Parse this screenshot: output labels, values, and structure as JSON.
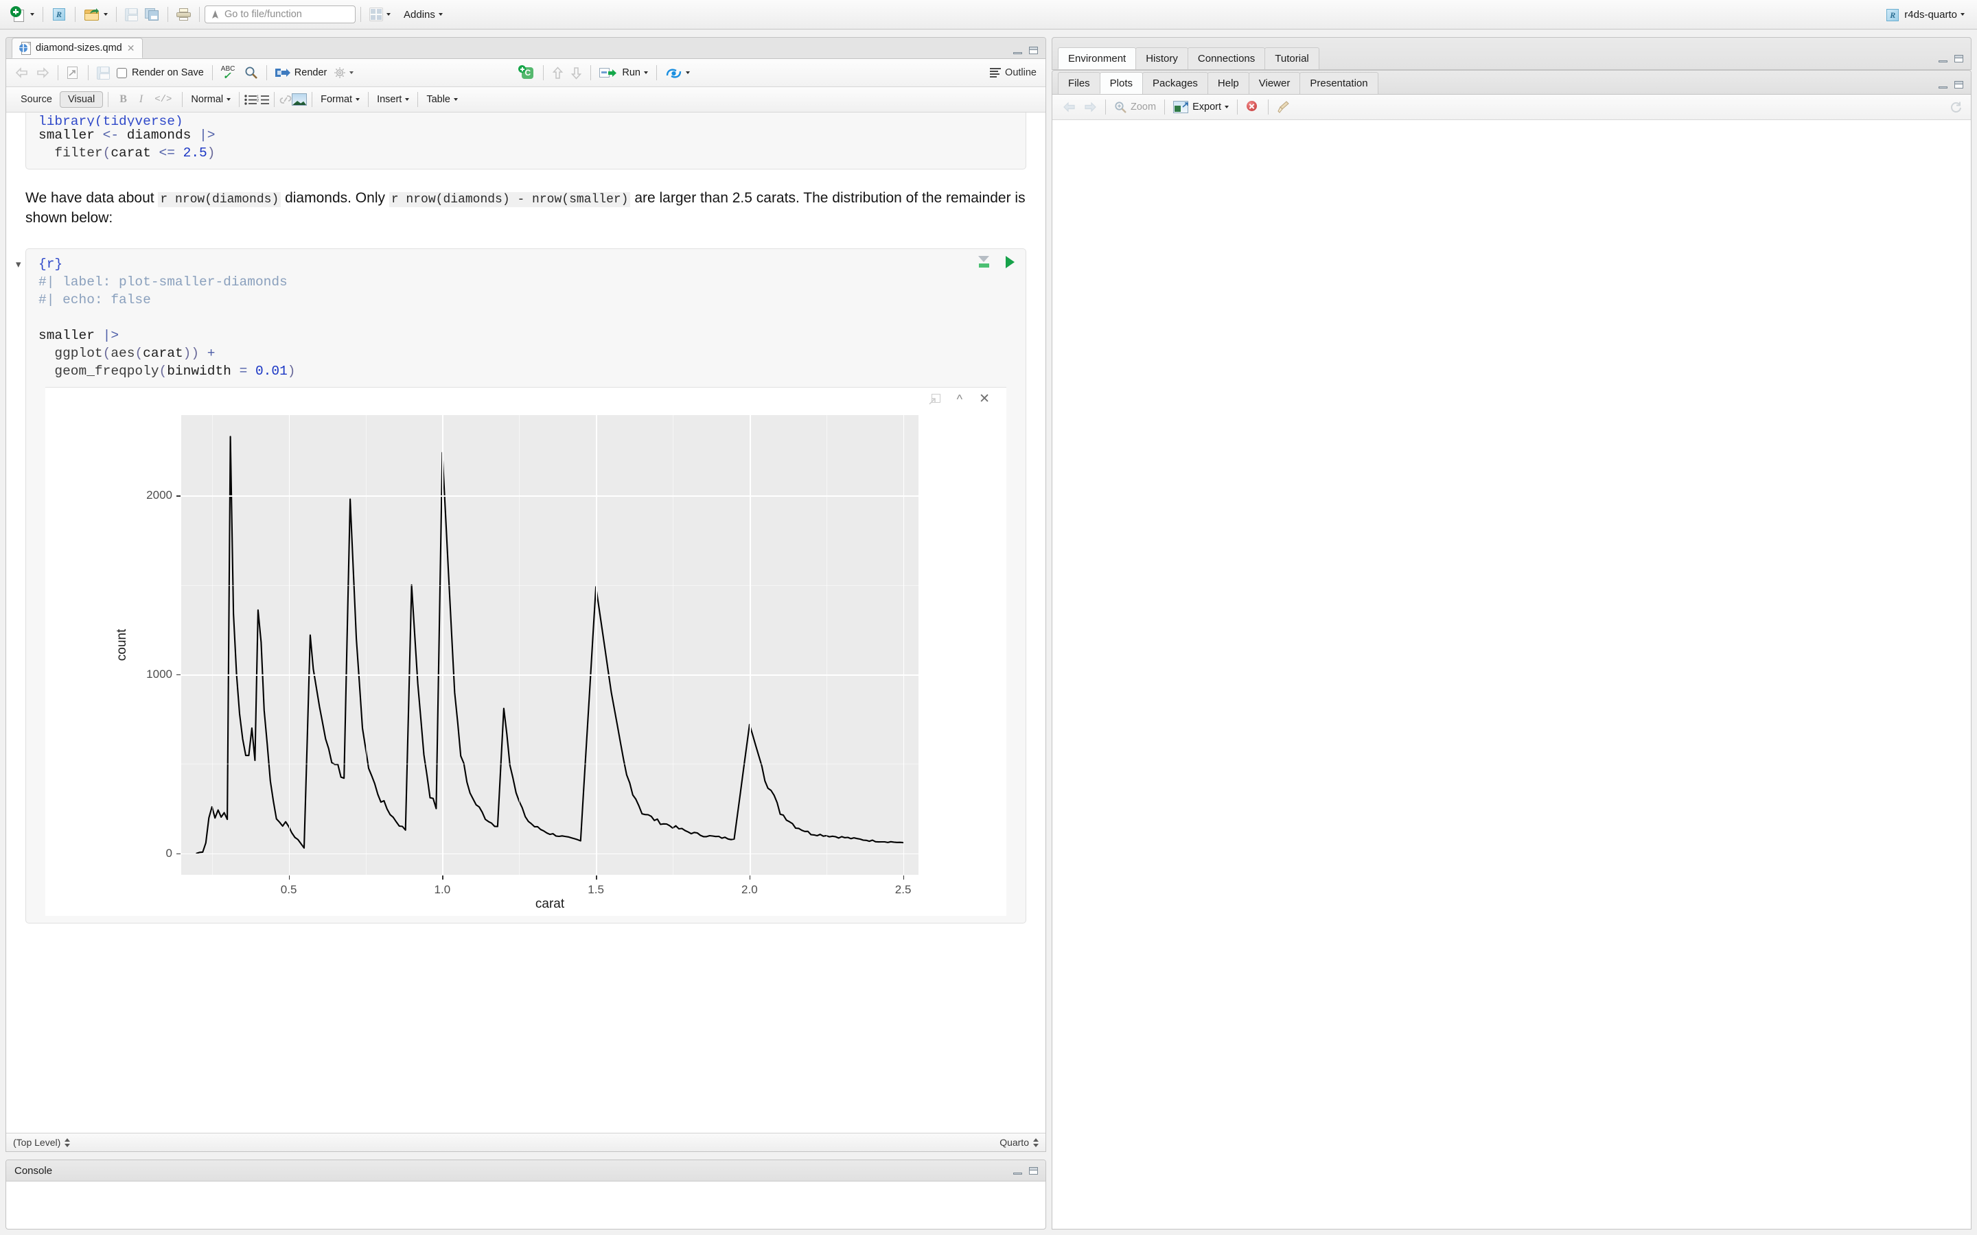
{
  "global_toolbar": {
    "new_file": "new-file-icon",
    "new_project": "new-project-icon",
    "open_file": "open-file-icon",
    "save": "save-icon",
    "save_all": "save-all-icon",
    "print": "print-icon",
    "goto_placeholder": "Go to file/function",
    "goto_value": "",
    "workspace_panes": "pane-layout-icon",
    "addins_label": "Addins",
    "project_name": "r4ds-quarto",
    "project_icon": "r-project-icon"
  },
  "source_pane": {
    "tabs": [
      {
        "label": "diamond-sizes.qmd",
        "icon": "quarto-doc-icon",
        "active": true
      }
    ],
    "editor_toolbar": {
      "back": "back-arrow-icon",
      "forward": "forward-arrow-icon",
      "show_in_new_window": "popout-icon",
      "save_label": "save-icon",
      "render_on_save_label": "Render on Save",
      "render_on_save_checked": false,
      "spellcheck": "spellcheck-icon",
      "find_replace": "find-icon",
      "render_label": "Render",
      "render_settings": "gear-icon",
      "insert_chunk": "insert-chunk-icon",
      "run_prev": "run-previous-icon",
      "run_next": "run-next-icon",
      "run_label": "Run",
      "rerun": "re-run-icon",
      "outline_label": "Outline"
    },
    "visual_toolbar": {
      "source_label": "Source",
      "visual_label": "Visual",
      "active_mode": "Visual",
      "bold": "bold-icon",
      "italic": "italic-icon",
      "code": "code-icon",
      "block_format": "Normal",
      "bullet_list": "bullet-list-icon",
      "numbered_list": "numbered-list-icon",
      "link": "link-icon",
      "image": "image-icon",
      "format_label": "Format",
      "insert_label": "Insert",
      "table_label": "Table"
    },
    "document": {
      "chunk_one": {
        "lines": [
          "library(tidyverse)",
          "",
          "smaller <- diamonds |>",
          "  filter(carat <= 2.5)"
        ]
      },
      "paragraph": {
        "seg1": "We have data about ",
        "code1": "r nrow(diamonds)",
        "seg2": " diamonds. Only ",
        "code2": "r nrow(diamonds) - nrow(smaller)",
        "seg3": " are larger than 2.5 carats. The distribution of the remainder is shown below:"
      },
      "chunk_two": {
        "header": "{r}",
        "opt_label": "#| label: plot-smaller-diamonds",
        "opt_echo": "#| echo: false",
        "code_lines": [
          "smaller |>",
          "  ggplot(aes(carat)) +",
          "  geom_freqpoly(binwidth = 0.01)"
        ],
        "settings_icon": "chunk-options-icon",
        "run_icon": "run-chunk-icon",
        "fold_icon": "chevron-down-icon"
      },
      "plot_output": {
        "popout_icon": "open-in-window-icon",
        "collapse_icon": "collapse-chevron-icon",
        "close_icon": "close-icon"
      }
    },
    "status_bar": {
      "scope": "(Top Level)",
      "doc_type": "Quarto"
    }
  },
  "chart_data": {
    "type": "line",
    "title": "",
    "xlabel": "carat",
    "ylabel": "count",
    "xlim": [
      0.15,
      2.55
    ],
    "ylim": [
      -120,
      2450
    ],
    "x_ticks": [
      0.5,
      1.0,
      1.5,
      2.0,
      2.5
    ],
    "x_tick_labels": [
      "0.5",
      "1.0",
      "1.5",
      "2.0",
      "2.5"
    ],
    "y_ticks": [
      0,
      1000,
      2000
    ],
    "y_tick_labels": [
      "0",
      "1000",
      "2000"
    ],
    "grid": true,
    "panel_bg": "#ebebeb",
    "line_color": "#000000",
    "binwidth": 0.01,
    "series_name": "count",
    "points": [
      [
        0.2,
        0
      ],
      [
        0.22,
        10
      ],
      [
        0.23,
        60
      ],
      [
        0.24,
        200
      ],
      [
        0.25,
        260
      ],
      [
        0.26,
        210
      ],
      [
        0.27,
        230
      ],
      [
        0.28,
        200
      ],
      [
        0.29,
        230
      ],
      [
        0.3,
        190
      ],
      [
        0.31,
        2330
      ],
      [
        0.32,
        1340
      ],
      [
        0.33,
        1000
      ],
      [
        0.34,
        780
      ],
      [
        0.35,
        640
      ],
      [
        0.36,
        560
      ],
      [
        0.37,
        530
      ],
      [
        0.38,
        700
      ],
      [
        0.39,
        520
      ],
      [
        0.4,
        1360
      ],
      [
        0.41,
        1180
      ],
      [
        0.42,
        800
      ],
      [
        0.43,
        600
      ],
      [
        0.44,
        430
      ],
      [
        0.45,
        290
      ],
      [
        0.46,
        200
      ],
      [
        0.47,
        170
      ],
      [
        0.48,
        160
      ],
      [
        0.49,
        175
      ],
      [
        0.5,
        150
      ],
      [
        0.51,
        120
      ],
      [
        0.52,
        95
      ],
      [
        0.54,
        50
      ],
      [
        0.55,
        30
      ],
      [
        0.57,
        1220
      ],
      [
        0.58,
        1030
      ],
      [
        0.6,
        820
      ],
      [
        0.62,
        640
      ],
      [
        0.64,
        530
      ],
      [
        0.66,
        470
      ],
      [
        0.68,
        420
      ],
      [
        0.7,
        1980
      ],
      [
        0.72,
        1200
      ],
      [
        0.74,
        700
      ],
      [
        0.76,
        480
      ],
      [
        0.78,
        380
      ],
      [
        0.8,
        300
      ],
      [
        0.82,
        250
      ],
      [
        0.84,
        200
      ],
      [
        0.86,
        160
      ],
      [
        0.88,
        130
      ],
      [
        0.9,
        1500
      ],
      [
        0.92,
        950
      ],
      [
        0.94,
        560
      ],
      [
        0.96,
        330
      ],
      [
        0.98,
        250
      ],
      [
        1.0,
        2240
      ],
      [
        1.02,
        1570
      ],
      [
        1.04,
        900
      ],
      [
        1.06,
        560
      ],
      [
        1.08,
        400
      ],
      [
        1.1,
        300
      ],
      [
        1.12,
        250
      ],
      [
        1.14,
        200
      ],
      [
        1.16,
        170
      ],
      [
        1.18,
        150
      ],
      [
        1.2,
        810
      ],
      [
        1.22,
        520
      ],
      [
        1.24,
        330
      ],
      [
        1.26,
        240
      ],
      [
        1.28,
        180
      ],
      [
        1.3,
        150
      ],
      [
        1.35,
        110
      ],
      [
        1.4,
        90
      ],
      [
        1.45,
        70
      ],
      [
        1.5,
        1490
      ],
      [
        1.55,
        900
      ],
      [
        1.6,
        430
      ],
      [
        1.65,
        230
      ],
      [
        1.7,
        180
      ],
      [
        1.75,
        150
      ],
      [
        1.8,
        120
      ],
      [
        1.85,
        100
      ],
      [
        1.9,
        90
      ],
      [
        1.95,
        80
      ],
      [
        2.0,
        720
      ],
      [
        2.05,
        430
      ],
      [
        2.1,
        230
      ],
      [
        2.15,
        150
      ],
      [
        2.2,
        110
      ],
      [
        2.3,
        90
      ],
      [
        2.4,
        70
      ],
      [
        2.5,
        60
      ]
    ],
    "peaks": [
      {
        "carat": 0.31,
        "count": 2330
      },
      {
        "carat": 0.4,
        "count": 1360
      },
      {
        "carat": 0.7,
        "count": 1980
      },
      {
        "carat": 0.9,
        "count": 1500
      },
      {
        "carat": 1.0,
        "count": 2240
      },
      {
        "carat": 1.2,
        "count": 810
      },
      {
        "carat": 1.5,
        "count": 1490
      },
      {
        "carat": 1.7,
        "count": 180
      },
      {
        "carat": 2.0,
        "count": 720
      }
    ]
  },
  "right_top_pane": {
    "tabs": [
      "Environment",
      "History",
      "Connections",
      "Tutorial"
    ],
    "active_tab": "Environment"
  },
  "right_bottom_pane": {
    "tabs": [
      "Files",
      "Plots",
      "Packages",
      "Help",
      "Viewer",
      "Presentation"
    ],
    "active_tab": "Plots",
    "toolbar": {
      "back": "back-arrow-icon",
      "forward": "forward-arrow-icon",
      "zoom_label": "Zoom",
      "export_label": "Export",
      "remove_plot": "remove-plot-icon",
      "clear_all": "clear-plots-icon",
      "refresh": "refresh-icon"
    }
  },
  "console_pane": {
    "title": "Console"
  }
}
